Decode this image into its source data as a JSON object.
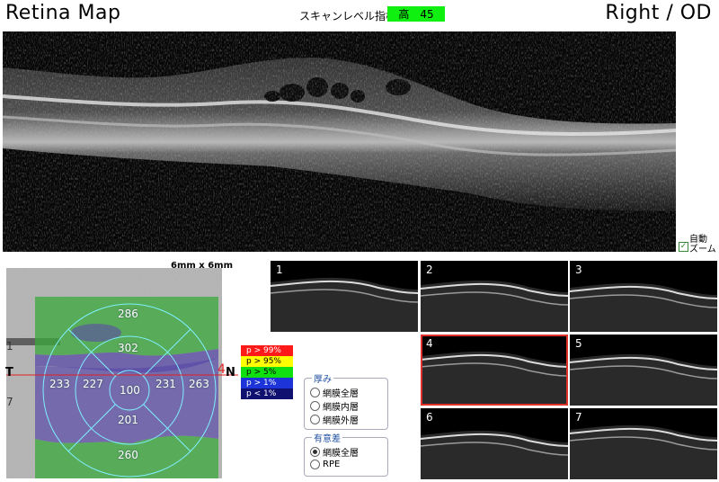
{
  "header": {
    "title": "Retina Map",
    "scan_quality_label": "スキャンレベル指標",
    "scan_quality_level": "高",
    "scan_quality_value": "45",
    "eye": "Right / OD"
  },
  "zoom": {
    "checked": true,
    "line1": "自動",
    "line2": "ズーム"
  },
  "map": {
    "size_label": "6mm x 6mm",
    "axis": {
      "top": "1",
      "bottom": "7",
      "temporal": "T",
      "marker": "4",
      "nasal": "N"
    },
    "values": {
      "outer_superior": "286",
      "inner_superior": "302",
      "outer_temporal": "233",
      "inner_temporal": "227",
      "center": "100",
      "inner_nasal": "231",
      "outer_nasal": "263",
      "inner_inferior": "201",
      "outer_inferior": "260"
    }
  },
  "legend": [
    {
      "label": "p > 99%",
      "color": "#ff1a1a"
    },
    {
      "label": "p > 95%",
      "color": "#ffff00"
    },
    {
      "label": "p > 5%",
      "color": "#10e010"
    },
    {
      "label": "p > 1%",
      "color": "#1d35d8"
    },
    {
      "label": "p < 1%",
      "color": "#101070"
    }
  ],
  "thickness_group": {
    "title": "厚み",
    "options": [
      "網膜全層",
      "網膜内層",
      "網膜外層"
    ],
    "selected": -1
  },
  "significance_group": {
    "title": "有意差",
    "options": [
      "網膜全層",
      "RPE"
    ],
    "selected": 0
  },
  "thumbnails": {
    "labels": [
      "1",
      "2",
      "3",
      "4",
      "5",
      "6",
      "7"
    ],
    "selected": "4"
  }
}
